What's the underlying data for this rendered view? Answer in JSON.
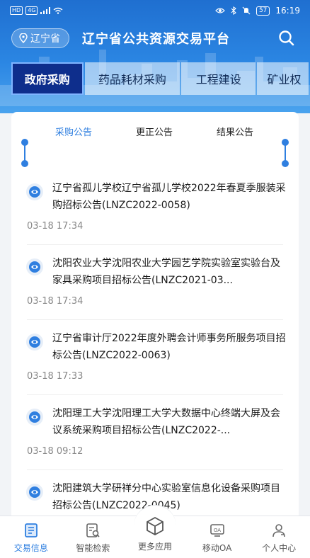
{
  "status_bar": {
    "left_chips": [
      "HD",
      "4G"
    ],
    "time": "16:19",
    "battery": "57"
  },
  "header": {
    "region": "辽宁省",
    "title": "辽宁省公共资源交易平台"
  },
  "category_tabs": [
    {
      "label": "政府采购",
      "active": true
    },
    {
      "label": "药品耗材采购",
      "active": false
    },
    {
      "label": "工程建设",
      "active": false
    },
    {
      "label": "矿业权",
      "active": false
    }
  ],
  "sub_tabs": [
    {
      "label": "采购公告",
      "active": true
    },
    {
      "label": "更正公告",
      "active": false
    },
    {
      "label": "结果公告",
      "active": false
    }
  ],
  "notices": [
    {
      "title": "辽宁省孤儿学校辽宁省孤儿学校2022年春夏季服装采购招标公告(LNZC2022-0058)",
      "time": "03-18 17:34"
    },
    {
      "title": "沈阳农业大学沈阳农业大学园艺学院实验室实验台及家具采购项目招标公告(LNZC2021-03...",
      "time": "03-18 17:34"
    },
    {
      "title": "辽宁省审计厅2022年度外聘会计师事务所服务项目招标公告(LNZC2022-0063)",
      "time": "03-18 17:33"
    },
    {
      "title": "沈阳理工大学沈阳理工大学大数据中心终端大屏及会议系统采购项目招标公告(LNZC2022-...",
      "time": "03-18 09:12"
    },
    {
      "title": "沈阳建筑大学研祥分中心实验室信息化设备采购项目招标公告(LNZC2022-0045)",
      "time": ""
    }
  ],
  "bottom_nav": [
    {
      "label": "交易信息",
      "icon": "trading-info-icon",
      "active": true
    },
    {
      "label": "智能检索",
      "icon": "smart-search-icon",
      "active": false
    },
    {
      "label": "更多应用",
      "icon": "cube-icon",
      "active": false
    },
    {
      "label": "移动OA",
      "icon": "oa-icon",
      "active": false
    },
    {
      "label": "个人中心",
      "icon": "user-icon",
      "active": false
    }
  ],
  "colors": {
    "header_blue": "#1f6fd0",
    "accent": "#2f7fe0",
    "active_tab": "#0e2e8c"
  }
}
